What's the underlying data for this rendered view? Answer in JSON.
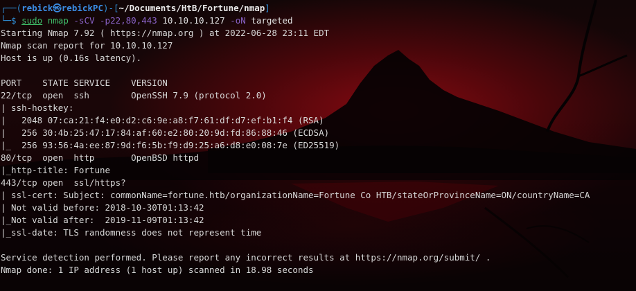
{
  "prompt": {
    "frame_top": "┌──(",
    "user_host": "rebick㉿rebickPC",
    "sep": ")-[",
    "path": "~/Documents/HtB/Fortune/nmap",
    "close": "]",
    "frame_bottom": "└─$ ",
    "sudo": "sudo",
    "cmd": "nmap",
    "opt1": "-sCV",
    "opt2": "-p22,80,443",
    "target": "10.10.10.127",
    "opt3": "-oN",
    "outfile": "targeted"
  },
  "output": [
    "Starting Nmap 7.92 ( https://nmap.org ) at 2022-06-28 23:11 EDT",
    "Nmap scan report for 10.10.10.127",
    "Host is up (0.16s latency).",
    "",
    "PORT    STATE SERVICE    VERSION",
    "22/tcp  open  ssh        OpenSSH 7.9 (protocol 2.0)",
    "| ssh-hostkey: ",
    "|   2048 07:ca:21:f4:e0:d2:c6:9e:a8:f7:61:df:d7:ef:b1:f4 (RSA)",
    "|   256 30:4b:25:47:17:84:af:60:e2:80:20:9d:fd:86:88:46 (ECDSA)",
    "|_  256 93:56:4a:ee:87:9d:f6:5b:f9:d9:25:a6:d8:e0:08:7e (ED25519)",
    "80/tcp  open  http       OpenBSD httpd",
    "|_http-title: Fortune",
    "443/tcp open  ssl/https?",
    "| ssl-cert: Subject: commonName=fortune.htb/organizationName=Fortune Co HTB/stateOrProvinceName=ON/countryName=CA",
    "| Not valid before: 2018-10-30T01:13:42",
    "|_Not valid after:  2019-11-09T01:13:42",
    "|_ssl-date: TLS randomness does not represent time",
    "",
    "Service detection performed. Please report any incorrect results at https://nmap.org/submit/ .",
    "Nmap done: 1 IP address (1 host up) scanned in 18.98 seconds"
  ]
}
